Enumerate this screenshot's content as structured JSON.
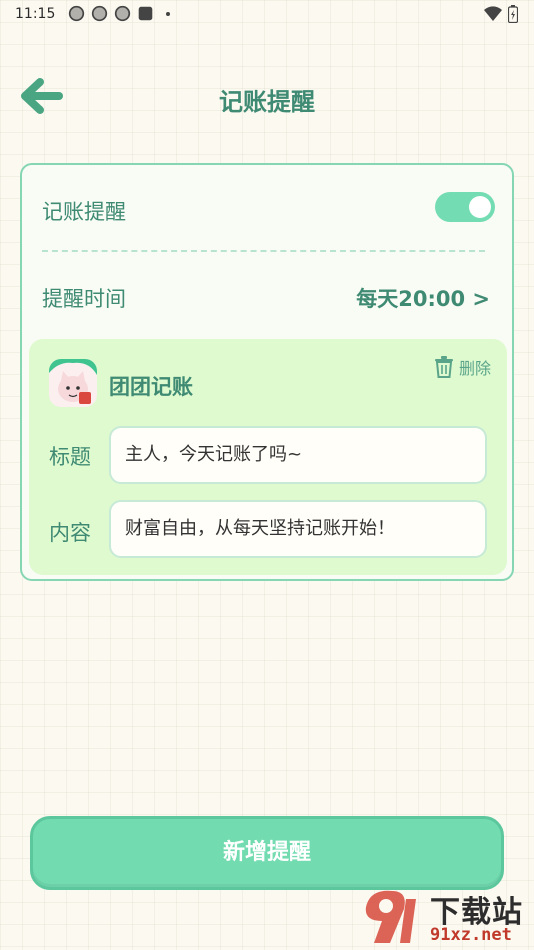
{
  "status_bar": {
    "time": "11:15",
    "icons": [
      "pinwheel-icon",
      "pinwheel-icon",
      "pinwheel-icon",
      "square-icon",
      "dot-icon"
    ],
    "right_icons": [
      "wifi-icon",
      "battery-icon"
    ]
  },
  "header": {
    "back_icon": "arrow-left-icon",
    "title": "记账提醒"
  },
  "settings": {
    "reminder_label": "记账提醒",
    "reminder_enabled": true,
    "time_label": "提醒时间",
    "time_value": "每天20:00 >"
  },
  "preview": {
    "app_name": "团团记账",
    "delete_label": "删除",
    "title_label": "标题",
    "title_value": "主人，今天记账了吗~",
    "content_label": "内容",
    "content_value": "财富自由，从每天坚持记账开始！"
  },
  "actions": {
    "add_label": "新增提醒"
  },
  "watermark": {
    "cn": "下载站",
    "en": "91xz.net"
  },
  "colors": {
    "accent": "#3f8a73",
    "toggle": "#74dcb2",
    "button": "#72dbb0",
    "preview_bg": "#e0fad0"
  }
}
